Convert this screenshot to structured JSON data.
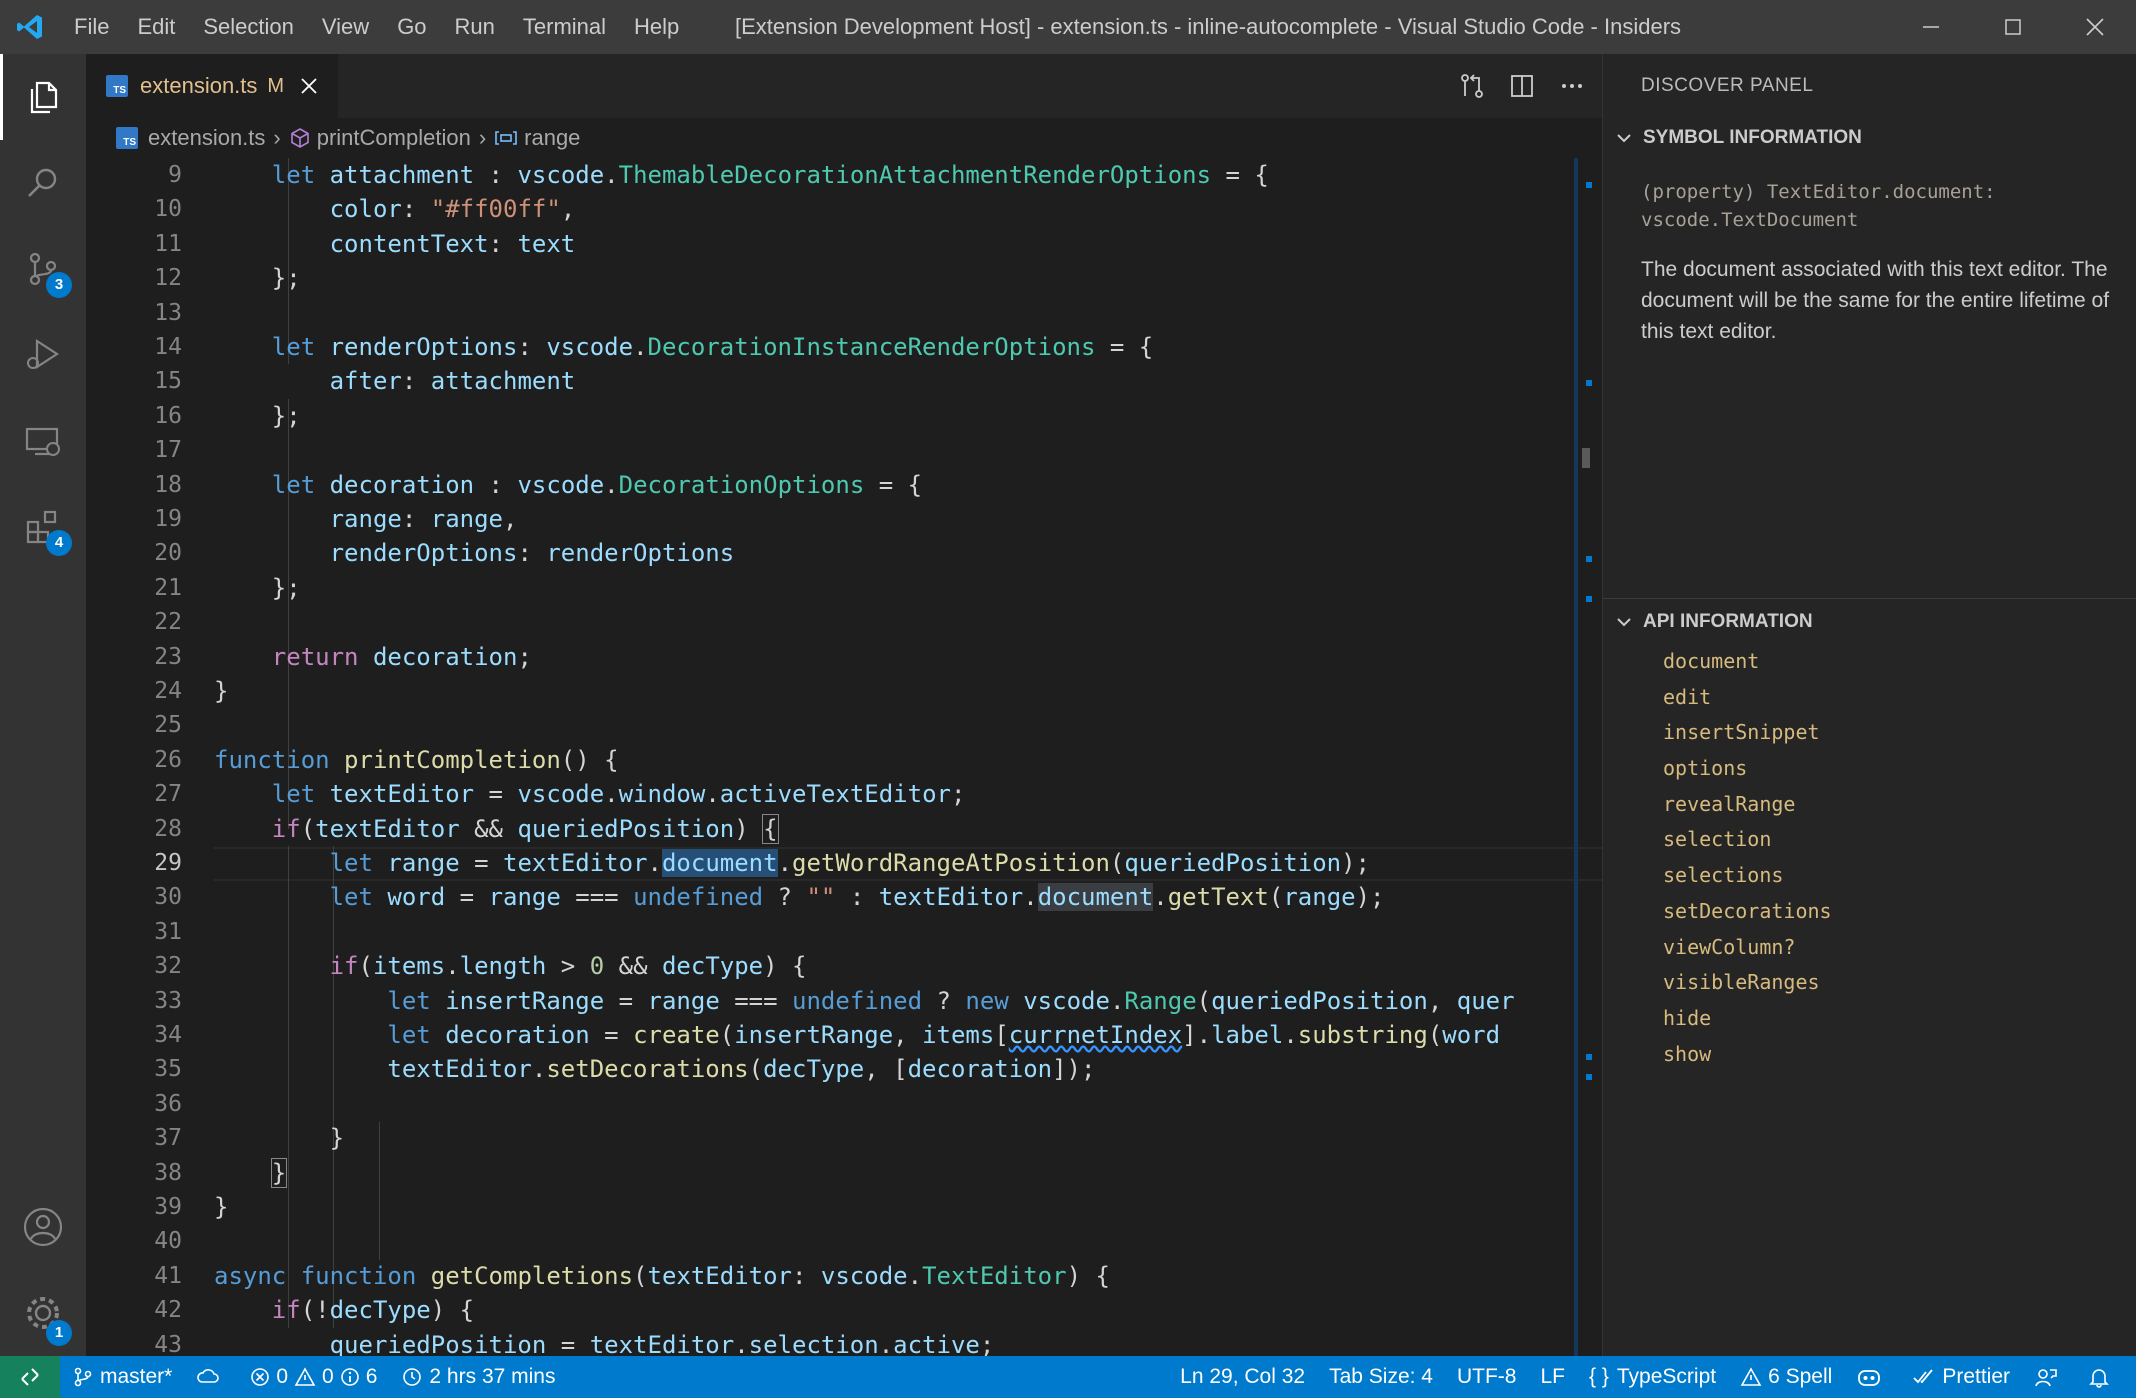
{
  "titlebar": {
    "menu": [
      "File",
      "Edit",
      "Selection",
      "View",
      "Go",
      "Run",
      "Terminal",
      "Help"
    ],
    "title": "[Extension Development Host] - extension.ts - inline-autocomplete - Visual Studio Code - Insiders"
  },
  "activity": {
    "badges": {
      "source_control": "3",
      "extensions": "4",
      "settings": "1"
    }
  },
  "tab": {
    "label": "extension.ts",
    "modified": "M",
    "icon_text": "TS"
  },
  "breadcrumb": {
    "file": "extension.ts",
    "function": "printCompletion",
    "variable": "range"
  },
  "editor": {
    "line_numbers": [
      "9",
      "10",
      "11",
      "12",
      "13",
      "14",
      "15",
      "16",
      "17",
      "18",
      "19",
      "20",
      "21",
      "22",
      "23",
      "24",
      "25",
      "26",
      "27",
      "28",
      "29",
      "30",
      "31",
      "32",
      "33",
      "34",
      "35",
      "36",
      "37",
      "38",
      "39",
      "40",
      "41",
      "42",
      "43"
    ],
    "current_line": "29"
  },
  "panel": {
    "title": "DISCOVER PANEL",
    "symbol_header": "SYMBOL INFORMATION",
    "symbol_signature": "(property) TextEditor.document: vscode.TextDocument",
    "symbol_description": "The document associated with this text editor. The document will be the same for the entire lifetime of this text editor.",
    "api_header": "API INFORMATION",
    "api_items": [
      "document",
      "edit",
      "insertSnippet",
      "options",
      "revealRange",
      "selection",
      "selections",
      "setDecorations",
      "viewColumn?",
      "visibleRanges",
      "hide",
      "show"
    ]
  },
  "status": {
    "branch": "master*",
    "errors": "0",
    "warnings": "0",
    "infos": "6",
    "time": "2 hrs 37 mins",
    "position": "Ln 29, Col 32",
    "tab_size": "Tab Size: 4",
    "encoding": "UTF-8",
    "eol": "LF",
    "language": "TypeScript",
    "spell": "6 Spell",
    "prettier": "Prettier"
  },
  "colors": {
    "accent": "#007acc",
    "remote": "#16825d",
    "titlebar": "#3c3c3c",
    "editor_bg": "#1e1e1e"
  }
}
